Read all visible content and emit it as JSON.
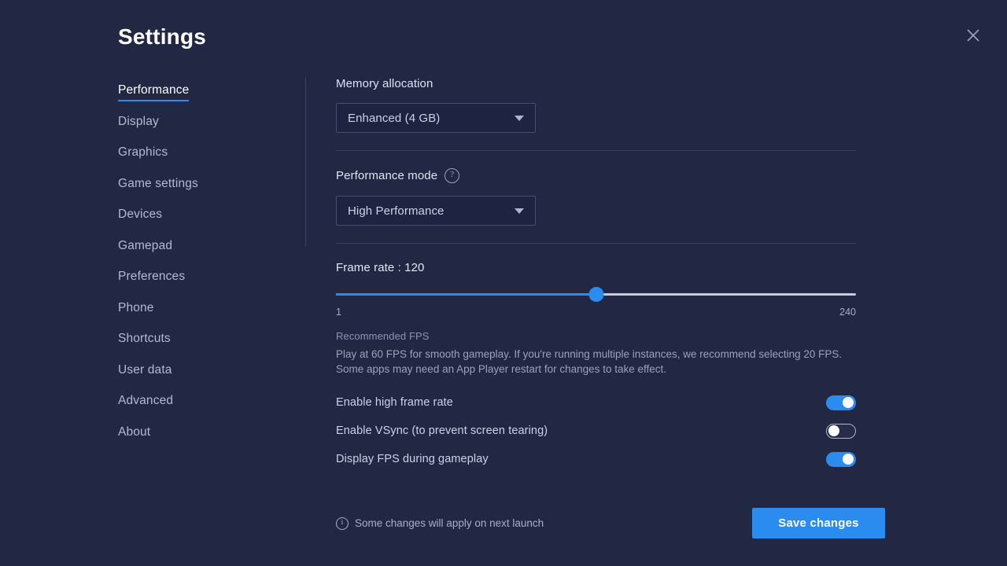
{
  "window": {
    "title": "Settings",
    "close_icon": "close-icon"
  },
  "sidebar": {
    "items": [
      {
        "label": "Performance",
        "active": true
      },
      {
        "label": "Display",
        "active": false
      },
      {
        "label": "Graphics",
        "active": false
      },
      {
        "label": "Game settings",
        "active": false
      },
      {
        "label": "Devices",
        "active": false
      },
      {
        "label": "Gamepad",
        "active": false
      },
      {
        "label": "Preferences",
        "active": false
      },
      {
        "label": "Phone",
        "active": false
      },
      {
        "label": "Shortcuts",
        "active": false
      },
      {
        "label": "User data",
        "active": false
      },
      {
        "label": "Advanced",
        "active": false
      },
      {
        "label": "About",
        "active": false
      }
    ]
  },
  "main": {
    "memory": {
      "label": "Memory allocation",
      "selected": "Enhanced (4 GB)",
      "caret_icon": "chevron-down-icon"
    },
    "performance_mode": {
      "label": "Performance mode",
      "help_icon": "help-circle-icon",
      "help_glyph": "?",
      "selected": "High Performance",
      "caret_icon": "chevron-down-icon"
    },
    "frame_rate": {
      "label": "Frame rate : 120",
      "value": 120,
      "min_label": "1",
      "max_label": "240",
      "min": 1,
      "max": 240,
      "percent": 50
    },
    "recommendation": {
      "title": "Recommended FPS",
      "body": "Play at 60 FPS for smooth gameplay. If you're running multiple instances, we recommend selecting 20 FPS. Some apps may need an App Player restart for changes to take effect."
    },
    "toggles": [
      {
        "label": "Enable high frame rate",
        "state": "on"
      },
      {
        "label": "Enable VSync (to prevent screen tearing)",
        "state": "off"
      },
      {
        "label": "Display FPS during gameplay",
        "state": "on"
      }
    ]
  },
  "footer": {
    "info_icon": "info-circle-icon",
    "info_glyph": "i",
    "note": "Some changes will apply on next launch",
    "save_label": "Save changes"
  },
  "colors": {
    "background": "#222744",
    "accent": "#2b8cf0",
    "panel": "#1d2340",
    "border": "#474d72",
    "divider": "#3a4062",
    "text_primary": "#ffffff",
    "text_secondary": "#ccd2e6",
    "text_muted": "#9aa1bd"
  }
}
